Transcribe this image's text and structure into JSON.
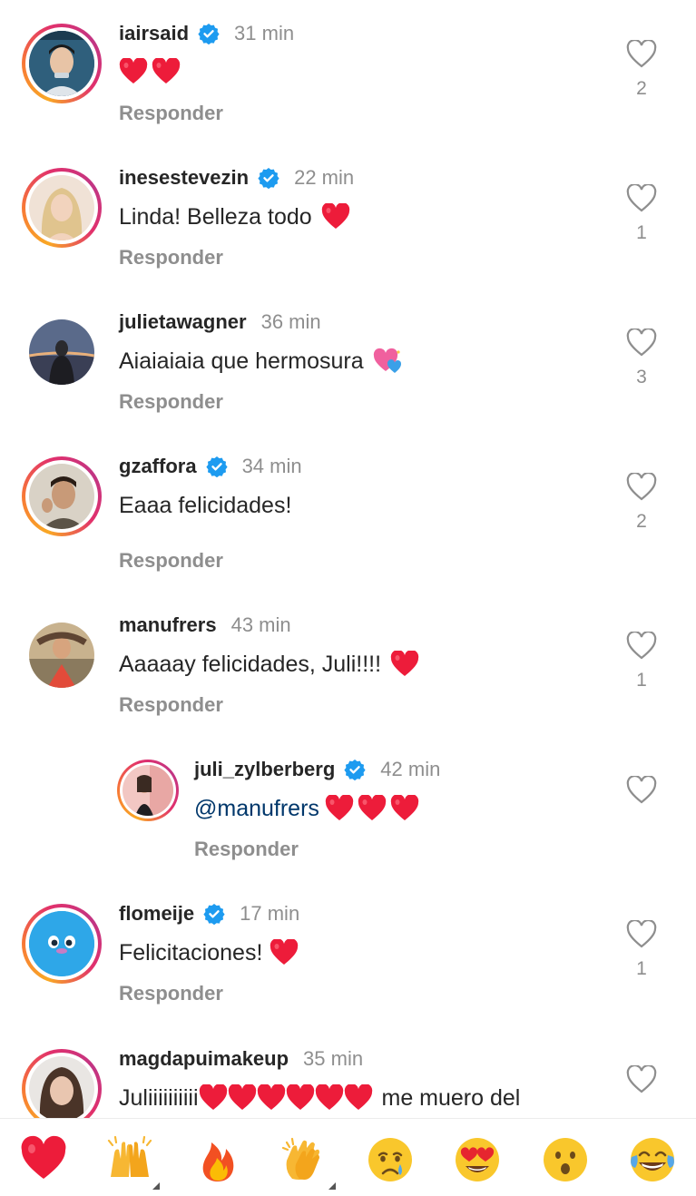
{
  "comments": [
    {
      "username": "iairsaid",
      "verified": true,
      "time": "31 min",
      "text": "",
      "hearts": 2,
      "likes": "2",
      "reply_label": "Responder",
      "avatar": "avatar-iairsaid"
    },
    {
      "username": "inesestevezin",
      "verified": true,
      "time": "22 min",
      "text": "Linda! Belleza todo",
      "hearts": 1,
      "likes": "1",
      "reply_label": "Responder",
      "avatar": "avatar-inesestevezin"
    },
    {
      "username": "julietawagner",
      "verified": false,
      "time": "36 min",
      "text": "Aiaiaiaia que hermosura",
      "sparkle_heart": true,
      "likes": "3",
      "reply_label": "Responder",
      "avatar": "avatar-julietawagner"
    },
    {
      "username": "gzaffora",
      "verified": true,
      "time": "34 min",
      "text": "Eaaa felicidades!",
      "hearts": 0,
      "likes": "2",
      "reply_label": "Responder",
      "avatar": "avatar-gzaffora"
    },
    {
      "username": "manufrers",
      "verified": false,
      "time": "43 min",
      "text": "Aaaaay felicidades, Juli!!!!",
      "hearts": 1,
      "likes": "1",
      "reply_label": "Responder",
      "avatar": "avatar-manufrers"
    },
    {
      "username": "juli_zylberberg",
      "verified": true,
      "time": "42 min",
      "mention": "@manufrers",
      "text": "",
      "hearts": 3,
      "likes": "",
      "reply_label": "Responder",
      "avatar": "avatar-juli-zylberberg"
    },
    {
      "username": "flomeije",
      "verified": true,
      "time": "17 min",
      "text": "Felicitaciones!",
      "hearts": 1,
      "likes": "1",
      "reply_label": "Responder",
      "avatar": "avatar-flomeije"
    },
    {
      "username": "magdapuimakeup",
      "verified": false,
      "time": "35 min",
      "text_before": "Juliiiiiiiiii",
      "hearts": 6,
      "text_after": "me muero del",
      "likes": "",
      "avatar": "avatar-magdapuimakeup"
    }
  ],
  "reactions": [
    {
      "emoji": "❤️",
      "icon": "red-heart-icon"
    },
    {
      "emoji": "🙌",
      "icon": "raising-hands-icon"
    },
    {
      "emoji": "🔥",
      "icon": "fire-icon"
    },
    {
      "emoji": "👏",
      "icon": "clapping-hands-icon"
    },
    {
      "emoji": "😢",
      "icon": "crying-face-icon"
    },
    {
      "emoji": "😍",
      "icon": "heart-eyes-icon"
    },
    {
      "emoji": "😮",
      "icon": "surprised-face-icon"
    },
    {
      "emoji": "😂",
      "icon": "tears-of-joy-icon"
    }
  ],
  "colors": {
    "verified": "#1d9bf0",
    "heart": "#ed1c3a",
    "username": "#262626",
    "muted": "#8e8e8e",
    "mention": "#00376b"
  }
}
